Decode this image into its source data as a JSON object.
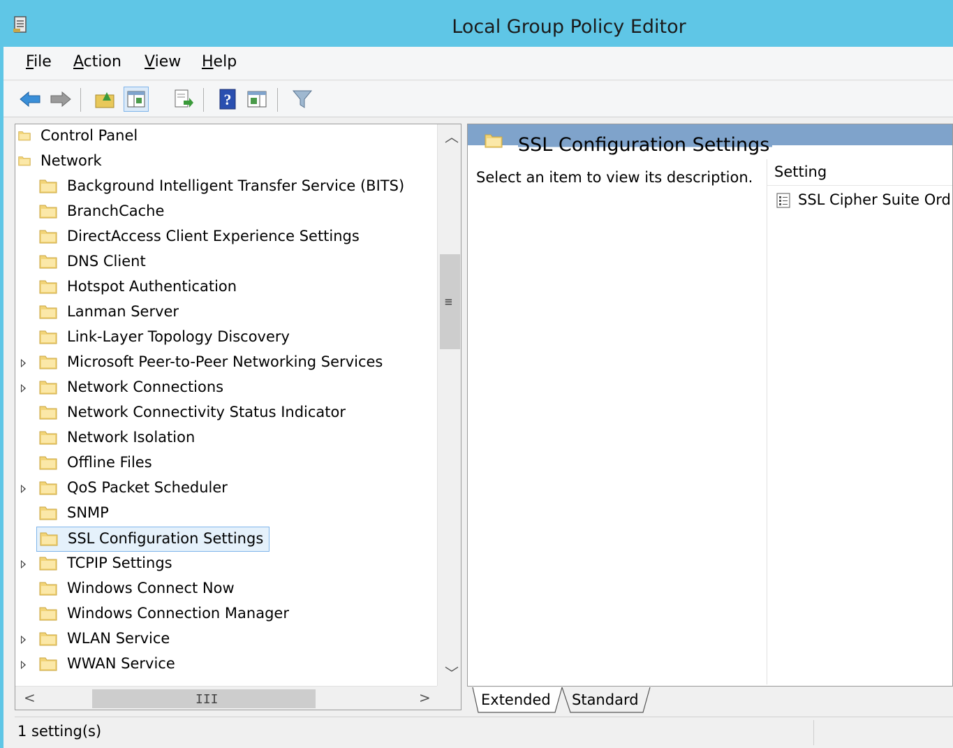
{
  "window": {
    "title": "Local Group Policy Editor",
    "accent_color": "#5fc6e6"
  },
  "menu": {
    "items": [
      {
        "label": "File",
        "mnemonic": "F",
        "rest": "ile"
      },
      {
        "label": "Action",
        "mnemonic": "A",
        "rest": "ction"
      },
      {
        "label": "View",
        "mnemonic": "V",
        "rest": "iew"
      },
      {
        "label": "Help",
        "mnemonic": "H",
        "rest": "elp"
      }
    ]
  },
  "toolbar": {
    "icons": [
      "back-arrow-icon",
      "forward-arrow-icon",
      "up-folder-icon",
      "show-hide-tree-icon",
      "export-list-icon",
      "help-icon",
      "show-hide-action-pane-icon",
      "filter-icon"
    ]
  },
  "tree": {
    "items": [
      {
        "label": "Control Panel",
        "level": 0,
        "expander": false
      },
      {
        "label": "Network",
        "level": 0,
        "expander": false
      },
      {
        "label": "Background Intelligent Transfer Service (BITS)",
        "level": 1,
        "expander": false
      },
      {
        "label": "BranchCache",
        "level": 1,
        "expander": false
      },
      {
        "label": "DirectAccess Client Experience Settings",
        "level": 1,
        "expander": false
      },
      {
        "label": "DNS Client",
        "level": 1,
        "expander": false
      },
      {
        "label": "Hotspot Authentication",
        "level": 1,
        "expander": false
      },
      {
        "label": "Lanman Server",
        "level": 1,
        "expander": false
      },
      {
        "label": "Link-Layer Topology Discovery",
        "level": 1,
        "expander": false
      },
      {
        "label": "Microsoft Peer-to-Peer Networking Services",
        "level": 1,
        "expander": true
      },
      {
        "label": "Network Connections",
        "level": 1,
        "expander": true
      },
      {
        "label": "Network Connectivity Status Indicator",
        "level": 1,
        "expander": false
      },
      {
        "label": "Network Isolation",
        "level": 1,
        "expander": false
      },
      {
        "label": "Offline Files",
        "level": 1,
        "expander": false
      },
      {
        "label": "QoS Packet Scheduler",
        "level": 1,
        "expander": true
      },
      {
        "label": "SNMP",
        "level": 1,
        "expander": false
      },
      {
        "label": "SSL Configuration Settings",
        "level": 1,
        "expander": false,
        "selected": true
      },
      {
        "label": "TCPIP Settings",
        "level": 1,
        "expander": true
      },
      {
        "label": "Windows Connect Now",
        "level": 1,
        "expander": false
      },
      {
        "label": "Windows Connection Manager",
        "level": 1,
        "expander": false
      },
      {
        "label": "WLAN Service",
        "level": 1,
        "expander": true
      },
      {
        "label": "WWAN Service",
        "level": 1,
        "expander": true
      }
    ]
  },
  "details": {
    "header_title": "SSL Configuration Settings",
    "description": "Select an item to view its description.",
    "column_header": "Setting",
    "rows": [
      "SSL Cipher Suite Ord"
    ]
  },
  "tabs": [
    {
      "label": "Extended",
      "active": true
    },
    {
      "label": "Standard",
      "active": false
    }
  ],
  "status": {
    "text": "1 setting(s)"
  },
  "scrollbar": {
    "grip": "III",
    "vgrip": "≡"
  }
}
